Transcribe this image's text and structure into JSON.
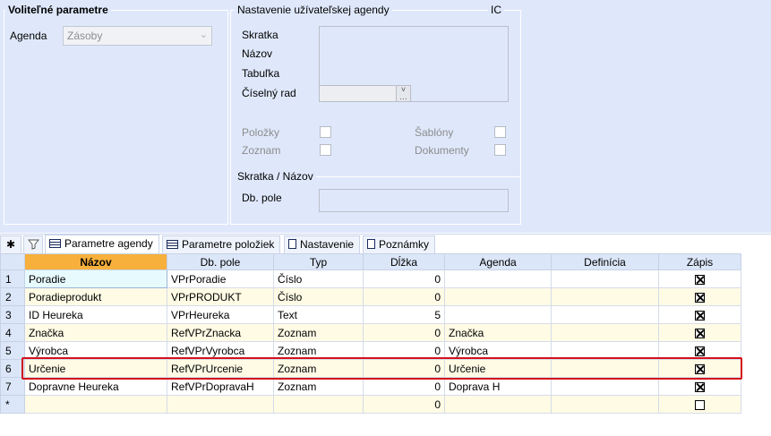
{
  "volitelne": {
    "title": "Voliteľné parametre",
    "agenda_label": "Agenda",
    "agenda_value": "Zásoby"
  },
  "nastavenie": {
    "title": "Nastavenie užívateľskej agendy",
    "ic": "IC",
    "skratka": "Skratka",
    "nazov": "Názov",
    "tabulka": "Tabuľka",
    "ciselny_rad": "Číselný rad",
    "polozky": "Položky",
    "zoznam": "Zoznam",
    "sablony": "Šablóny",
    "dokumenty": "Dokumenty",
    "skratka_nazov_title": "Skratka / Názov",
    "db_pole": "Db. pole"
  },
  "tabs": {
    "star": "✱",
    "parametre_agendy": "Parametre agendy",
    "parametre_poloziek": "Parametre položiek",
    "nastavenie": "Nastavenie",
    "poznamky": "Poznámky"
  },
  "grid": {
    "columns": [
      "Názov",
      "Db. pole",
      "Typ",
      "Dĺžka",
      "Agenda",
      "Definícia",
      "Zápis"
    ],
    "rows": [
      {
        "n": "1",
        "nazov": "Poradie",
        "db": "VPrPoradie",
        "typ": "Číslo",
        "dlzka": "0",
        "agenda": "",
        "definicia": "",
        "zapis": true
      },
      {
        "n": "2",
        "nazov": "Poradieprodukt",
        "db": "VPrPRODUKT",
        "typ": "Číslo",
        "dlzka": "0",
        "agenda": "",
        "definicia": "",
        "zapis": true
      },
      {
        "n": "3",
        "nazov": "ID Heureka",
        "db": "VPrHeureka",
        "typ": "Text",
        "dlzka": "5",
        "agenda": "",
        "definicia": "",
        "zapis": true
      },
      {
        "n": "4",
        "nazov": "Značka",
        "db": "RefVPrZnacka",
        "typ": "Zoznam",
        "dlzka": "0",
        "agenda": "Značka",
        "definicia": "",
        "zapis": true
      },
      {
        "n": "5",
        "nazov": "Výrobca",
        "db": "RefVPrVyrobca",
        "typ": "Zoznam",
        "dlzka": "0",
        "agenda": "Výrobca",
        "definicia": "",
        "zapis": true
      },
      {
        "n": "6",
        "nazov": "Určenie",
        "db": "RefVPrUrcenie",
        "typ": "Zoznam",
        "dlzka": "0",
        "agenda": "Určenie",
        "definicia": "",
        "zapis": true
      },
      {
        "n": "7",
        "nazov": "Dopravne Heureka",
        "db": "RefVPrDopravaH",
        "typ": "Zoznam",
        "dlzka": "0",
        "agenda": "Doprava H",
        "definicia": "",
        "zapis": true
      },
      {
        "n": "*",
        "nazov": "",
        "db": "",
        "typ": "",
        "dlzka": "0",
        "agenda": "",
        "definicia": "",
        "zapis": false
      }
    ]
  },
  "colors": {
    "panel_bg": "#dfe8fb",
    "sorted_header": "#f7b03c",
    "highlight": "#d4121a",
    "alt_row": "#fffbe5"
  }
}
